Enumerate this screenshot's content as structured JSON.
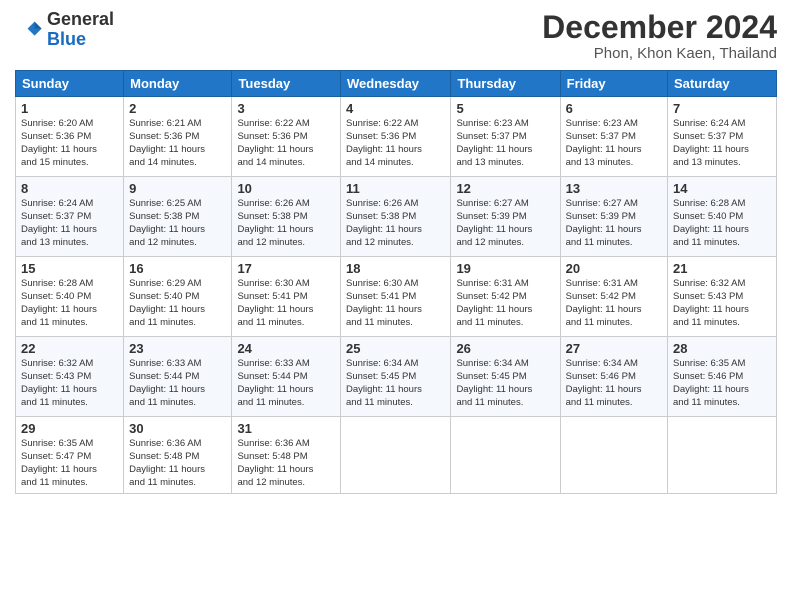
{
  "header": {
    "logo_general": "General",
    "logo_blue": "Blue",
    "month": "December 2024",
    "location": "Phon, Khon Kaen, Thailand"
  },
  "weekdays": [
    "Sunday",
    "Monday",
    "Tuesday",
    "Wednesday",
    "Thursday",
    "Friday",
    "Saturday"
  ],
  "weeks": [
    [
      {
        "day": "1",
        "info": "Sunrise: 6:20 AM\nSunset: 5:36 PM\nDaylight: 11 hours\nand 15 minutes."
      },
      {
        "day": "2",
        "info": "Sunrise: 6:21 AM\nSunset: 5:36 PM\nDaylight: 11 hours\nand 14 minutes."
      },
      {
        "day": "3",
        "info": "Sunrise: 6:22 AM\nSunset: 5:36 PM\nDaylight: 11 hours\nand 14 minutes."
      },
      {
        "day": "4",
        "info": "Sunrise: 6:22 AM\nSunset: 5:36 PM\nDaylight: 11 hours\nand 14 minutes."
      },
      {
        "day": "5",
        "info": "Sunrise: 6:23 AM\nSunset: 5:37 PM\nDaylight: 11 hours\nand 13 minutes."
      },
      {
        "day": "6",
        "info": "Sunrise: 6:23 AM\nSunset: 5:37 PM\nDaylight: 11 hours\nand 13 minutes."
      },
      {
        "day": "7",
        "info": "Sunrise: 6:24 AM\nSunset: 5:37 PM\nDaylight: 11 hours\nand 13 minutes."
      }
    ],
    [
      {
        "day": "8",
        "info": "Sunrise: 6:24 AM\nSunset: 5:37 PM\nDaylight: 11 hours\nand 13 minutes."
      },
      {
        "day": "9",
        "info": "Sunrise: 6:25 AM\nSunset: 5:38 PM\nDaylight: 11 hours\nand 12 minutes."
      },
      {
        "day": "10",
        "info": "Sunrise: 6:26 AM\nSunset: 5:38 PM\nDaylight: 11 hours\nand 12 minutes."
      },
      {
        "day": "11",
        "info": "Sunrise: 6:26 AM\nSunset: 5:38 PM\nDaylight: 11 hours\nand 12 minutes."
      },
      {
        "day": "12",
        "info": "Sunrise: 6:27 AM\nSunset: 5:39 PM\nDaylight: 11 hours\nand 12 minutes."
      },
      {
        "day": "13",
        "info": "Sunrise: 6:27 AM\nSunset: 5:39 PM\nDaylight: 11 hours\nand 11 minutes."
      },
      {
        "day": "14",
        "info": "Sunrise: 6:28 AM\nSunset: 5:40 PM\nDaylight: 11 hours\nand 11 minutes."
      }
    ],
    [
      {
        "day": "15",
        "info": "Sunrise: 6:28 AM\nSunset: 5:40 PM\nDaylight: 11 hours\nand 11 minutes."
      },
      {
        "day": "16",
        "info": "Sunrise: 6:29 AM\nSunset: 5:40 PM\nDaylight: 11 hours\nand 11 minutes."
      },
      {
        "day": "17",
        "info": "Sunrise: 6:30 AM\nSunset: 5:41 PM\nDaylight: 11 hours\nand 11 minutes."
      },
      {
        "day": "18",
        "info": "Sunrise: 6:30 AM\nSunset: 5:41 PM\nDaylight: 11 hours\nand 11 minutes."
      },
      {
        "day": "19",
        "info": "Sunrise: 6:31 AM\nSunset: 5:42 PM\nDaylight: 11 hours\nand 11 minutes."
      },
      {
        "day": "20",
        "info": "Sunrise: 6:31 AM\nSunset: 5:42 PM\nDaylight: 11 hours\nand 11 minutes."
      },
      {
        "day": "21",
        "info": "Sunrise: 6:32 AM\nSunset: 5:43 PM\nDaylight: 11 hours\nand 11 minutes."
      }
    ],
    [
      {
        "day": "22",
        "info": "Sunrise: 6:32 AM\nSunset: 5:43 PM\nDaylight: 11 hours\nand 11 minutes."
      },
      {
        "day": "23",
        "info": "Sunrise: 6:33 AM\nSunset: 5:44 PM\nDaylight: 11 hours\nand 11 minutes."
      },
      {
        "day": "24",
        "info": "Sunrise: 6:33 AM\nSunset: 5:44 PM\nDaylight: 11 hours\nand 11 minutes."
      },
      {
        "day": "25",
        "info": "Sunrise: 6:34 AM\nSunset: 5:45 PM\nDaylight: 11 hours\nand 11 minutes."
      },
      {
        "day": "26",
        "info": "Sunrise: 6:34 AM\nSunset: 5:45 PM\nDaylight: 11 hours\nand 11 minutes."
      },
      {
        "day": "27",
        "info": "Sunrise: 6:34 AM\nSunset: 5:46 PM\nDaylight: 11 hours\nand 11 minutes."
      },
      {
        "day": "28",
        "info": "Sunrise: 6:35 AM\nSunset: 5:46 PM\nDaylight: 11 hours\nand 11 minutes."
      }
    ],
    [
      {
        "day": "29",
        "info": "Sunrise: 6:35 AM\nSunset: 5:47 PM\nDaylight: 11 hours\nand 11 minutes."
      },
      {
        "day": "30",
        "info": "Sunrise: 6:36 AM\nSunset: 5:48 PM\nDaylight: 11 hours\nand 11 minutes."
      },
      {
        "day": "31",
        "info": "Sunrise: 6:36 AM\nSunset: 5:48 PM\nDaylight: 11 hours\nand 12 minutes."
      },
      null,
      null,
      null,
      null
    ]
  ]
}
